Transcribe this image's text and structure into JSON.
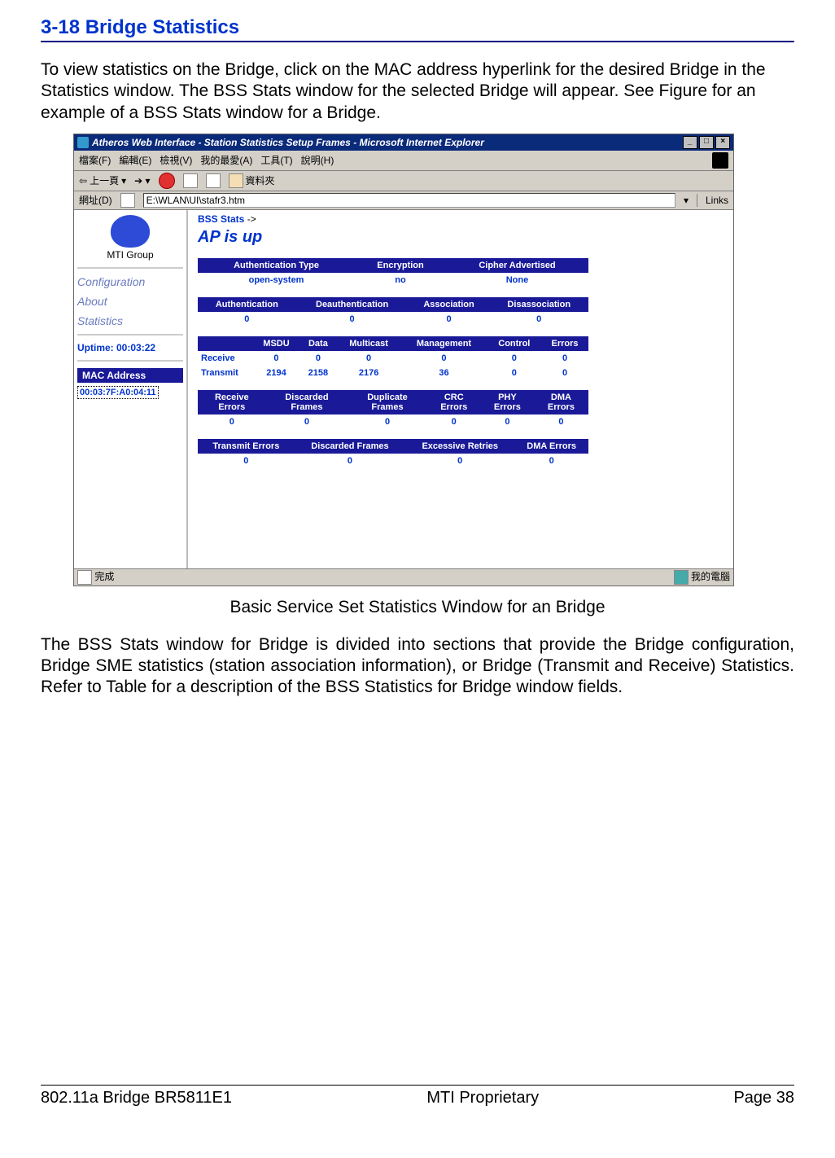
{
  "document": {
    "section_title": "3-18 Bridge Statistics",
    "intro_text": "To view statistics on the Bridge, click on the MAC address hyperlink for the desired Bridge in the Statistics window. The BSS Stats window for the selected Bridge will appear. See Figure for an example of a BSS Stats window for a Bridge.",
    "figure_caption": "Basic Service Set Statistics Window for an Bridge",
    "body_text_2": "The BSS Stats window for Bridge is divided into sections that provide the Bridge configuration, Bridge SME statistics (station association information), or Bridge (Transmit and Receive) Statistics. Refer to Table for a description of the BSS Statistics for Bridge window fields.",
    "footer_left": "802.11a Bridge BR5811E1",
    "footer_center": "MTI Proprietary",
    "footer_right": "Page 38"
  },
  "browser": {
    "window_title": "Atheros Web Interface - Station Statistics Setup Frames - Microsoft Internet Explorer",
    "menu": {
      "file": "檔案(F)",
      "edit": "編輯(E)",
      "view": "檢視(V)",
      "favorites": "我的最愛(A)",
      "tools": "工具(T)",
      "help": "說明(H)"
    },
    "toolbar": {
      "back": "上一頁",
      "folder": "資料夾"
    },
    "address_label": "網址(D)",
    "address_value": "E:\\WLAN\\UI\\stafr3.htm",
    "links_label": "Links",
    "status_done": "完成",
    "status_zone": "我的電腦"
  },
  "sidebar": {
    "logo_label": "MTI Group",
    "links": {
      "config": "Configuration",
      "about": "About",
      "stats": "Statistics"
    },
    "uptime": "Uptime: 00:03:22",
    "mac_header": "MAC Address",
    "mac_value": "00:03:7F:A0:04:11"
  },
  "main": {
    "crumb_prefix": "BSS Stats",
    "crumb_arrow": "->",
    "ap_status": "AP is  up",
    "table1": {
      "headers": [
        "Authentication Type",
        "Encryption",
        "Cipher Advertised"
      ],
      "row": [
        "open-system",
        "no",
        "None"
      ]
    },
    "table2": {
      "headers": [
        "Authentication",
        "Deauthentication",
        "Association",
        "Disassociation"
      ],
      "row": [
        "0",
        "0",
        "0",
        "0"
      ]
    },
    "table3": {
      "headers": [
        "",
        "MSDU",
        "Data",
        "Multicast",
        "Management",
        "Control",
        "Errors"
      ],
      "rows": [
        {
          "label": "Receive",
          "v": [
            "0",
            "0",
            "0",
            "0",
            "0",
            "0"
          ]
        },
        {
          "label": "Transmit",
          "v": [
            "2194",
            "2158",
            "2176",
            "36",
            "0",
            "0"
          ]
        }
      ]
    },
    "table4": {
      "headers": [
        "Receive Errors",
        "Discarded Frames",
        "Duplicate Frames",
        "CRC Errors",
        "PHY Errors",
        "DMA Errors"
      ],
      "row": [
        "0",
        "0",
        "0",
        "0",
        "0",
        "0"
      ]
    },
    "table5": {
      "headers": [
        "Transmit Errors",
        "Discarded Frames",
        "Excessive Retries",
        "DMA Errors"
      ],
      "row": [
        "0",
        "0",
        "0",
        "0"
      ]
    }
  }
}
